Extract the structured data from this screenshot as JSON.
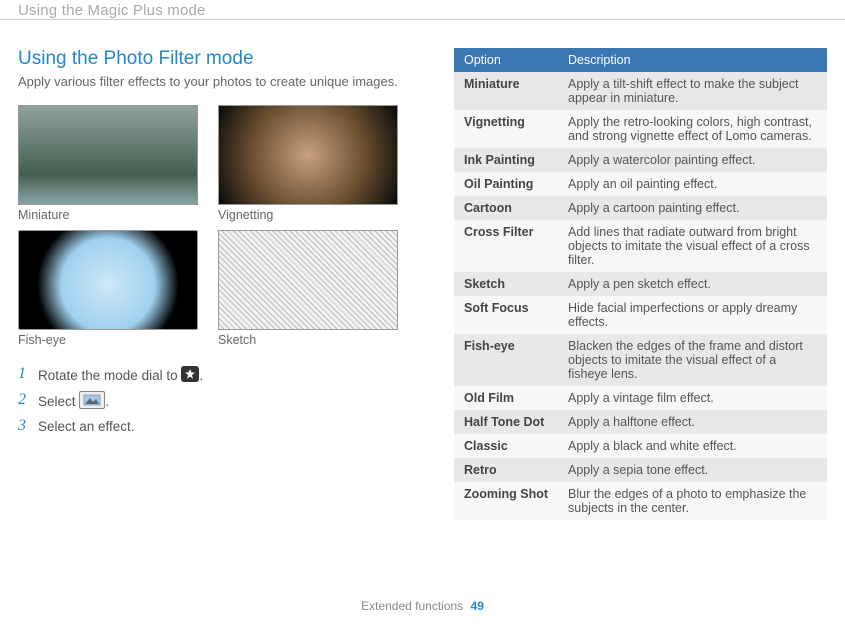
{
  "topbar": "Using the Magic Plus mode",
  "left": {
    "title": "Using the Photo Filter mode",
    "intro": "Apply various filter effects to your photos to create unique images.",
    "samples": [
      {
        "caption": "Miniature",
        "thumb_class": "miniature"
      },
      {
        "caption": "Vignetting",
        "thumb_class": "vignetting"
      },
      {
        "caption": "Fish-eye",
        "thumb_class": "fisheye"
      },
      {
        "caption": "Sketch",
        "thumb_class": "sketch"
      }
    ],
    "steps": [
      {
        "n": "1",
        "text_before": "Rotate the mode dial to ",
        "icon": "magic-plus-mode-icon",
        "text_after": "."
      },
      {
        "n": "2",
        "text_before": "Select ",
        "icon": "photo-filter-icon",
        "text_after": "."
      },
      {
        "n": "3",
        "text_before": "Select an effect.",
        "icon": null,
        "text_after": ""
      }
    ]
  },
  "right": {
    "header": {
      "col1": "Option",
      "col2": "Description"
    },
    "rows": [
      {
        "name": "Miniature",
        "desc": "Apply a tilt-shift effect to make the subject appear in miniature."
      },
      {
        "name": "Vignetting",
        "desc": "Apply the retro-looking colors, high contrast, and strong vignette effect of Lomo cameras."
      },
      {
        "name": "Ink Painting",
        "desc": "Apply a watercolor painting effect."
      },
      {
        "name": "Oil Painting",
        "desc": "Apply an oil painting effect."
      },
      {
        "name": "Cartoon",
        "desc": "Apply a cartoon painting effect."
      },
      {
        "name": "Cross Filter",
        "desc": "Add lines that radiate outward from bright objects to imitate the visual effect of a cross filter."
      },
      {
        "name": "Sketch",
        "desc": "Apply a pen sketch effect."
      },
      {
        "name": "Soft Focus",
        "desc": "Hide facial imperfections or apply dreamy effects."
      },
      {
        "name": "Fish-eye",
        "desc": "Blacken the edges of the frame and distort objects to imitate the visual effect of a fisheye lens."
      },
      {
        "name": "Old Film",
        "desc": "Apply a vintage film effect."
      },
      {
        "name": "Half Tone Dot",
        "desc": "Apply a halftone effect."
      },
      {
        "name": "Classic",
        "desc": "Apply a black and white effect."
      },
      {
        "name": "Retro",
        "desc": "Apply a sepia tone effect."
      },
      {
        "name": "Zooming Shot",
        "desc": "Blur the edges of a photo to emphasize the subjects in the center."
      }
    ]
  },
  "footer": {
    "label": "Extended functions",
    "page": "49"
  }
}
